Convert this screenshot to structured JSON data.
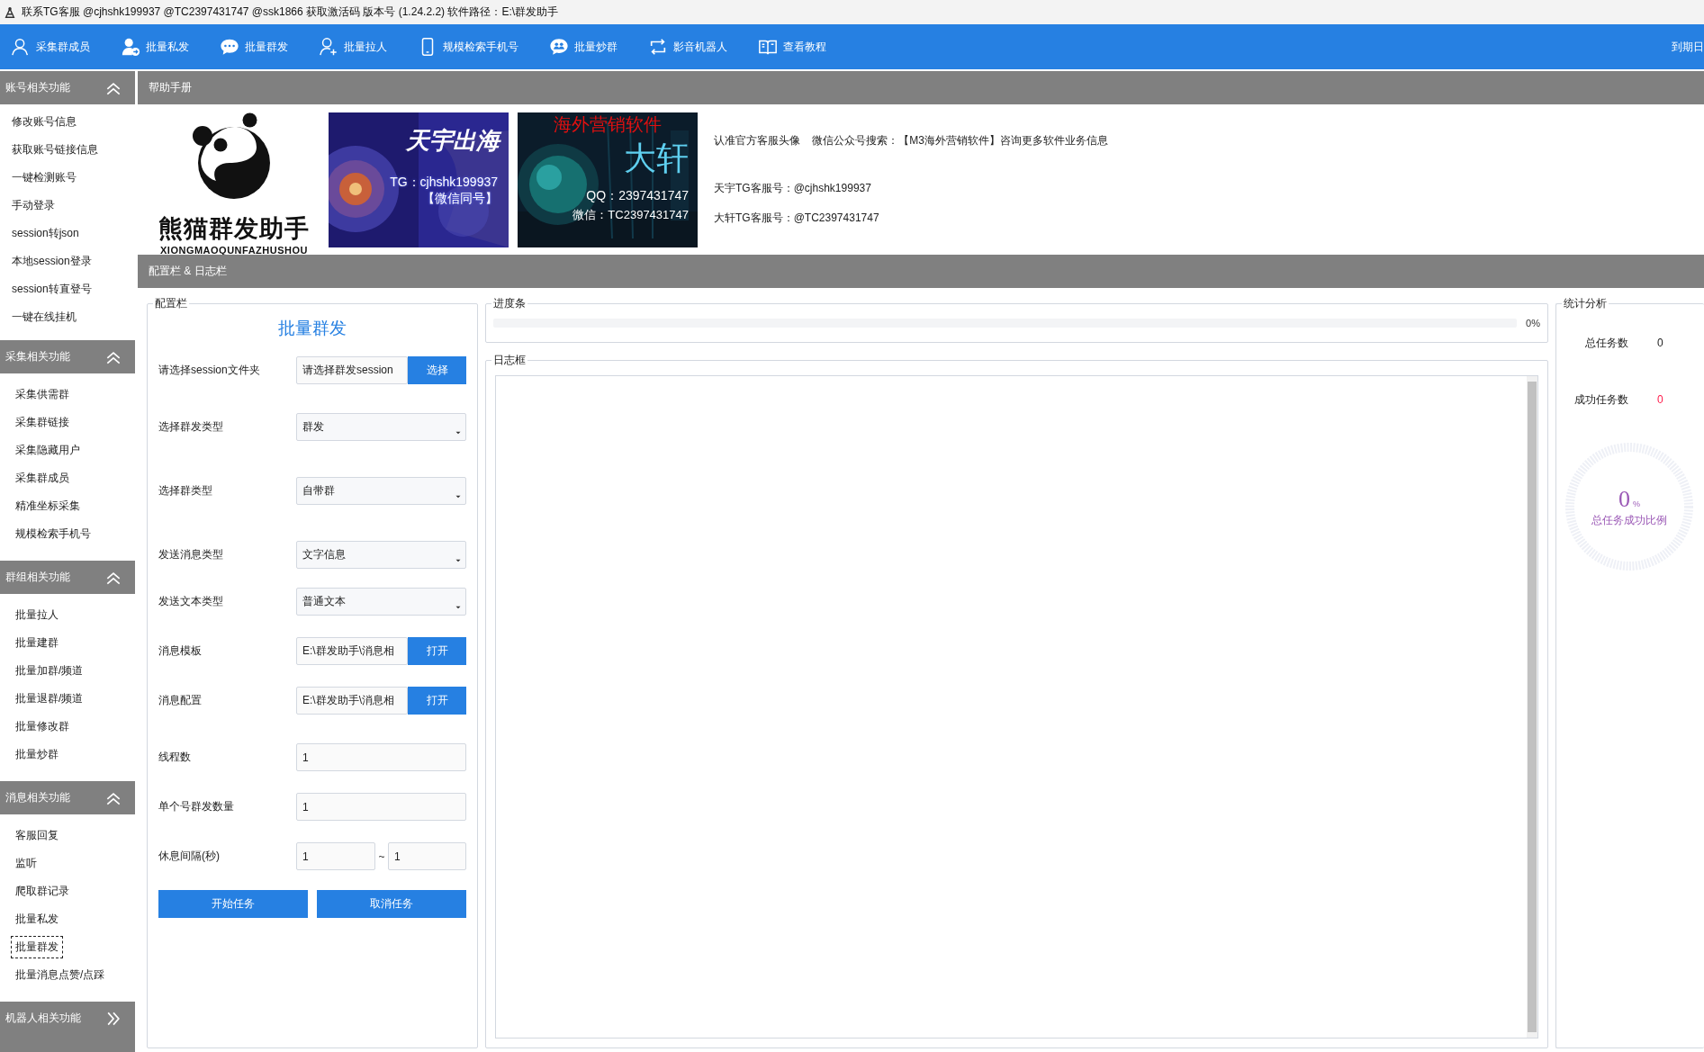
{
  "window": {
    "title": "联系TG客服 @cjhshk199937 @TC2397431747 @ssk1866 获取激活码 版本号 (1.24.2.2) 软件路径：E:\\群发助手"
  },
  "toolbar": {
    "items": [
      {
        "label": "采集群成员"
      },
      {
        "label": "批量私发"
      },
      {
        "label": "批量群发"
      },
      {
        "label": "批量拉人"
      },
      {
        "label": "规模检索手机号"
      },
      {
        "label": "批量炒群"
      },
      {
        "label": "影音机器人"
      },
      {
        "label": "查看教程"
      }
    ],
    "expiry": "到期日"
  },
  "sidebar": {
    "sections": [
      {
        "title": "账号相关功能",
        "expanded": true,
        "items": [
          {
            "label": "修改账号信息",
            "selected": false
          },
          {
            "label": "获取账号链接信息",
            "selected": false
          },
          {
            "label": "一键检测账号",
            "selected": false
          },
          {
            "label": "手动登录",
            "selected": false
          },
          {
            "label": "session转json",
            "selected": false
          },
          {
            "label": "本地session登录",
            "selected": false
          },
          {
            "label": "session转直登号",
            "selected": false
          },
          {
            "label": "一键在线挂机",
            "selected": false
          }
        ]
      },
      {
        "title": "采集相关功能",
        "expanded": true,
        "items": [
          {
            "label": "采集供需群",
            "selected": false
          },
          {
            "label": "采集群链接",
            "selected": false
          },
          {
            "label": "采集隐藏用户",
            "selected": false
          },
          {
            "label": "采集群成员",
            "selected": false
          },
          {
            "label": "精准坐标采集",
            "selected": false
          },
          {
            "label": "规模检索手机号",
            "selected": false
          }
        ]
      },
      {
        "title": "群组相关功能",
        "expanded": true,
        "items": [
          {
            "label": "批量拉人",
            "selected": false
          },
          {
            "label": "批量建群",
            "selected": false
          },
          {
            "label": "批量加群/频道",
            "selected": false
          },
          {
            "label": "批量退群/频道",
            "selected": false
          },
          {
            "label": "批量修改群",
            "selected": false
          },
          {
            "label": "批量炒群",
            "selected": false
          }
        ]
      },
      {
        "title": "消息相关功能",
        "expanded": true,
        "items": [
          {
            "label": "客服回复",
            "selected": false
          },
          {
            "label": "监听",
            "selected": false
          },
          {
            "label": "爬取群记录",
            "selected": false
          },
          {
            "label": "批量私发",
            "selected": false
          },
          {
            "label": "批量群发",
            "selected": true
          },
          {
            "label": "批量消息点赞/点踩",
            "selected": false
          }
        ]
      },
      {
        "title": "机器人相关功能",
        "expanded": false
      }
    ]
  },
  "help": {
    "header": "帮助手册",
    "logo": {
      "name": "熊猫群发助手",
      "pinyin": "XIONGMAOQUNFAZHUSHOU"
    },
    "banners": [
      {
        "kind": "tianyu",
        "title": "天宇出海",
        "lines": [
          "TG：cjhshk199937",
          "【微信同号】"
        ]
      },
      {
        "kind": "daxuan",
        "top": "海外营销软件",
        "title": "大轩",
        "lines": [
          "QQ：2397431747",
          "微信：TC2397431747"
        ]
      }
    ],
    "info": [
      "认准官方客服头像    微信公众号搜索：【M3海外营销软件】咨询更多软件业务信息",
      "天宇TG客服号：@cjhshk199937",
      "大轩TG客服号：@TC2397431747"
    ]
  },
  "config_header": "配置栏 & 日志栏",
  "config": {
    "legend": "配置栏",
    "title": "批量群发",
    "rows": [
      {
        "kind": "file",
        "label": "请选择session文件夹",
        "value": "请选择群发session",
        "button": "选择"
      },
      {
        "kind": "select",
        "label": "选择群发类型",
        "value": "群发"
      },
      {
        "kind": "select",
        "label": "选择群类型",
        "value": "自带群"
      },
      {
        "kind": "select",
        "label": "发送消息类型",
        "value": "文字信息"
      },
      {
        "kind": "select",
        "label": "发送文本类型",
        "value": "普通文本"
      },
      {
        "kind": "file",
        "label": "消息模板",
        "value": "E:\\群发助手\\消息相",
        "button": "打开"
      },
      {
        "kind": "file",
        "label": "消息配置",
        "value": "E:\\群发助手\\消息相",
        "button": "打开"
      },
      {
        "kind": "text",
        "label": "线程数",
        "value": "1"
      },
      {
        "kind": "text",
        "label": "单个号群发数量",
        "value": "1"
      },
      {
        "kind": "range",
        "label": "休息间隔(秒)",
        "from": "1",
        "separator": "~",
        "to": "1"
      }
    ],
    "buttons": [
      "开始任务",
      "取消任务"
    ]
  },
  "progress": {
    "legend": "进度条",
    "level": 0,
    "reading": "0%"
  },
  "log": {
    "legend": "日志框"
  },
  "stats": {
    "legend": "统计分析",
    "rows": [
      {
        "label": "总任务数",
        "value": "0",
        "kind": "normal"
      },
      {
        "label": "成功任务数",
        "value": "0",
        "kind": "success"
      }
    ],
    "gauge": {
      "value": "0",
      "unit": "%",
      "label": "总任务成功比例"
    }
  }
}
